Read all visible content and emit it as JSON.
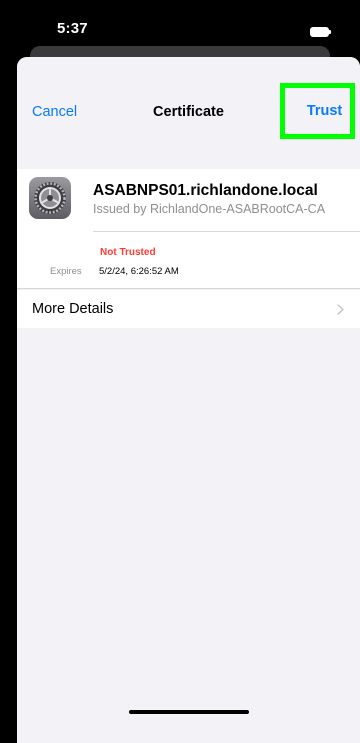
{
  "status_bar": {
    "time": "5:37"
  },
  "nav": {
    "cancel_label": "Cancel",
    "title": "Certificate",
    "trust_label": "Trust"
  },
  "certificate": {
    "icon": "settings-gear-icon",
    "name": "ASABNPS01.richlandone.local",
    "issuer": "Issued by RichlandOne-ASABRootCA-CA",
    "trust_status": "Not Trusted",
    "expires_label": "Expires",
    "expires_value": "5/2/24, 6:26:52 AM"
  },
  "details": {
    "label": "More Details"
  },
  "colors": {
    "accent": "#0a7aff",
    "warning": "#ff3b30",
    "highlight": "#00ff00"
  }
}
